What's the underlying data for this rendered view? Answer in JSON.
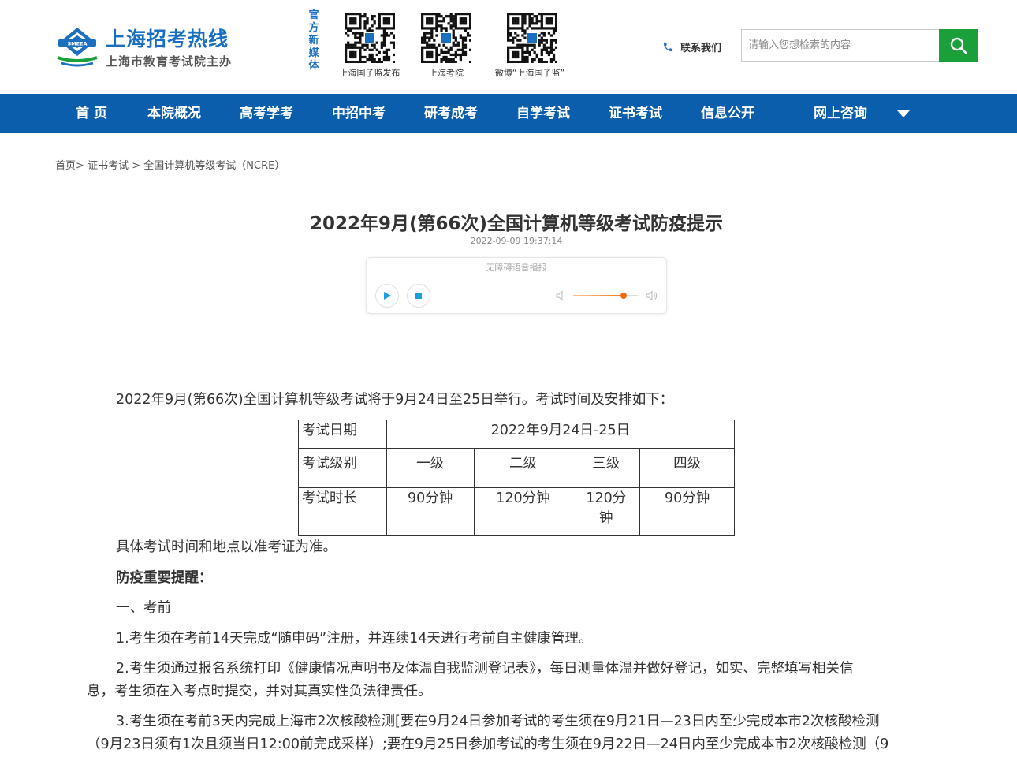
{
  "site": {
    "title": "上海招考热线",
    "subtitle": "上海市教育考试院主办",
    "logo_text": "SMEEA",
    "colors": {
      "brand_blue": "#1a6fc0",
      "nav_blue": "#0b5eac",
      "search_green": "#1a9f3a",
      "volume_orange": "#f26a10"
    }
  },
  "media": {
    "label": "官方新媒体",
    "chars": [
      "官",
      "方",
      "新",
      "媒",
      "体"
    ],
    "qrcodes": [
      {
        "caption": "上海国子监发布"
      },
      {
        "caption": "上海考院"
      },
      {
        "caption": "微博“上海国子监”"
      }
    ]
  },
  "contact": {
    "label": "联系我们",
    "icon": "phone-icon"
  },
  "search": {
    "placeholder": "请输入您想检索的内容",
    "icon": "search-icon"
  },
  "nav": {
    "items": [
      "首 页",
      "本院概况",
      "高考学考",
      "中招中考",
      "研考成考",
      "自学考试",
      "证书考试",
      "信息公开",
      "网上咨询"
    ],
    "more_icon": "caret-down-icon"
  },
  "breadcrumb": {
    "home": "首页",
    "level1": "证书考试",
    "level2": "全国计算机等级考试（NCRE）",
    "sep": ">"
  },
  "article": {
    "title": "2022年9月(第66次)全国计算机等级考试防疫提示",
    "date": "2022-09-09 19:37:14",
    "player": {
      "label": "无障碍语音播报",
      "volume": 0.78,
      "play_icon": "play-icon",
      "stop_icon": "stop-icon",
      "vol_low_icon": "volume-low-icon",
      "vol_high_icon": "volume-high-icon"
    },
    "intro": "2022年9月(第66次)全国计算机等级考试将于9月24日至25日举行。考试时间及安排如下：",
    "table": {
      "date_label": "考试日期",
      "date_value": "2022年9月24日-25日",
      "level_label": "考试级别",
      "levels": [
        "一级",
        "二级",
        "三级",
        "四级"
      ],
      "duration_label": "考试时长",
      "durations": [
        "90分钟",
        "120分钟",
        "120分",
        "90分钟"
      ],
      "duration_wrap": "钟"
    },
    "note": "具体考试时间和地点以准考证为准。",
    "heading": "防疫重要提醒：",
    "section1": "一、考前",
    "items": [
      {
        "line1": "1.考生须在考前14天完成“随申码”注册，并连续14天进行考前自主健康管理。"
      },
      {
        "line1": "2.考生须通过报名系统打印《健康情况声明书及体温自我监测登记表》，每日测量体温并做好登记，如实、完整填写相关信",
        "line2": "息，考生须在入考点时提交，并对其真实性负法律责任。"
      },
      {
        "line1": "3.考生须在考前3天内完成上海市2次核酸检测[要在9月24日参加考试的考生须在9月21日—23日内至少完成本市2次核酸检测",
        "line2": "（9月23日须有1次且须当日12:00前完成采样）;要在9月25日参加考试的考生须在9月22日—24日内至少完成本市2次核酸检测（9"
      }
    ]
  }
}
